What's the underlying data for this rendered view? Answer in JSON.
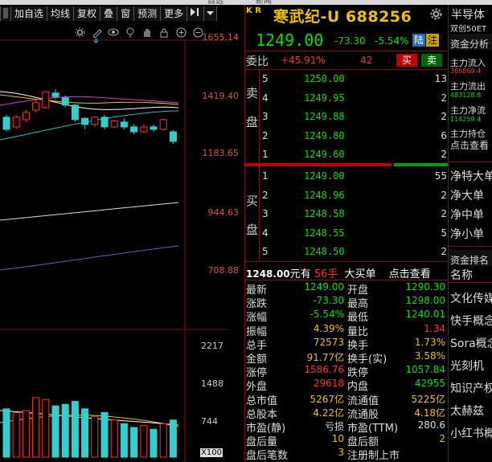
{
  "topstrip": {
    "left_text": "自选",
    "right_text": "新闻"
  },
  "toolbar": {
    "buttons": [
      "加自选",
      "均线",
      "复权",
      "叠",
      "窗",
      "预测",
      "更多"
    ]
  },
  "chart": {
    "price_axis": [
      "1655.14",
      "1419.40",
      "1183.65",
      "944.63",
      "708.88"
    ],
    "volume_axis": [
      "2217",
      "1488",
      "744"
    ],
    "volume_unit": "X100",
    "diamond": "◆"
  },
  "chart_data": {
    "type": "candlestick",
    "ylim": [
      708.88,
      1655.14
    ],
    "candles": [
      {
        "o": 1350,
        "c": 1300,
        "h": 1360,
        "l": 1290,
        "up": false
      },
      {
        "o": 1310,
        "c": 1350,
        "h": 1360,
        "l": 1300,
        "up": true
      },
      {
        "o": 1340,
        "c": 1370,
        "h": 1380,
        "l": 1330,
        "up": true
      },
      {
        "o": 1380,
        "c": 1410,
        "h": 1420,
        "l": 1370,
        "up": true
      },
      {
        "o": 1390,
        "c": 1455,
        "h": 1460,
        "l": 1385,
        "up": true
      },
      {
        "o": 1450,
        "c": 1435,
        "h": 1465,
        "l": 1425,
        "up": false
      },
      {
        "o": 1430,
        "c": 1400,
        "h": 1440,
        "l": 1390,
        "up": false
      },
      {
        "o": 1400,
        "c": 1340,
        "h": 1405,
        "l": 1330,
        "up": false
      },
      {
        "o": 1345,
        "c": 1320,
        "h": 1350,
        "l": 1300,
        "up": false
      },
      {
        "o": 1320,
        "c": 1350,
        "h": 1355,
        "l": 1310,
        "up": true
      },
      {
        "o": 1350,
        "c": 1310,
        "h": 1360,
        "l": 1300,
        "up": false
      },
      {
        "o": 1310,
        "c": 1335,
        "h": 1340,
        "l": 1305,
        "up": true
      },
      {
        "o": 1330,
        "c": 1310,
        "h": 1345,
        "l": 1300,
        "up": false
      },
      {
        "o": 1310,
        "c": 1290,
        "h": 1320,
        "l": 1280,
        "up": false
      },
      {
        "o": 1290,
        "c": 1310,
        "h": 1320,
        "l": 1285,
        "up": true
      },
      {
        "o": 1310,
        "c": 1300,
        "h": 1320,
        "l": 1290,
        "up": false
      },
      {
        "o": 1300,
        "c": 1340,
        "h": 1345,
        "l": 1295,
        "up": true
      },
      {
        "o": 1290,
        "c": 1250,
        "h": 1298,
        "l": 1240,
        "up": false
      }
    ],
    "volumes": [
      1300,
      1200,
      1250,
      1600,
      1550,
      1380,
      1420,
      1500,
      1300,
      1100,
      1200,
      1000,
      900,
      800,
      850,
      750,
      900,
      1000
    ]
  },
  "quote": {
    "kr": "K R",
    "name": "寒武纪-U 688256",
    "price": "1249.00",
    "change": "-73.30",
    "percent": "-5.54%",
    "flag1": "陆",
    "flag2": "注",
    "weibi_label": "委比",
    "weibi_value": "+45.91%",
    "weicha_value": "42",
    "buy_label": "买",
    "sell_label": "卖",
    "ask_side": "卖盘",
    "bid_side": "买盘",
    "asks": [
      {
        "level": "5",
        "price": "1250.00",
        "vol": "13"
      },
      {
        "level": "4",
        "price": "1249.95",
        "vol": "2"
      },
      {
        "level": "3",
        "price": "1249.88",
        "vol": "2"
      },
      {
        "level": "2",
        "price": "1249.80",
        "vol": "6"
      },
      {
        "level": "1",
        "price": "1249.60",
        "vol": "2"
      }
    ],
    "bids": [
      {
        "level": "1",
        "price": "1249.00",
        "vol": "55"
      },
      {
        "level": "2",
        "price": "1248.96",
        "vol": "2"
      },
      {
        "level": "3",
        "price": "1248.58",
        "vol": "2"
      },
      {
        "level": "4",
        "price": "1248.55",
        "vol": "5"
      },
      {
        "level": "5",
        "price": "1248.50",
        "vol": "2"
      }
    ],
    "big_order": {
      "amount": "1248.00",
      "unit": "元有",
      "qty": "56手",
      "type": "大买单",
      "link": "点击查看"
    },
    "stats": [
      {
        "l1": "最新",
        "v1": "1249.00",
        "c1": "g",
        "l2": "开盘",
        "v2": "1290.30",
        "c2": "g"
      },
      {
        "l1": "涨跌",
        "v1": "-73.30",
        "c1": "g",
        "l2": "最高",
        "v2": "1298.00",
        "c2": "g"
      },
      {
        "l1": "涨幅",
        "v1": "-5.54%",
        "c1": "g",
        "l2": "最低",
        "v2": "1240.01",
        "c2": "g"
      },
      {
        "l1": "振幅",
        "v1": "4.39%",
        "c1": "y",
        "l2": "量比",
        "v2": "1.34",
        "c2": "r"
      },
      {
        "l1": "总手",
        "v1": "72573",
        "c1": "y",
        "l2": "换手",
        "v2": "1.73%",
        "c2": "y"
      },
      {
        "l1": "金额",
        "v1": "91.77亿",
        "c1": "y",
        "l2": "换手(实)",
        "v2": "3.58%",
        "c2": "y"
      },
      {
        "l1": "涨停",
        "v1": "1586.76",
        "c1": "r",
        "l2": "跌停",
        "v2": "1057.84",
        "c2": "g"
      },
      {
        "l1": "外盘",
        "v1": "29618",
        "c1": "r",
        "l2": "内盘",
        "v2": "42955",
        "c2": "g"
      },
      {
        "l1": "总市值",
        "v1": "5267亿",
        "c1": "y",
        "l2": "流通值",
        "v2": "5225亿",
        "c2": "y"
      },
      {
        "l1": "总股本",
        "v1": "4.22亿",
        "c1": "y",
        "l2": "流通股",
        "v2": "4.18亿",
        "c2": "y"
      },
      {
        "l1": "市盈(静)",
        "v1": "亏损",
        "c1": "w",
        "l2": "市盈(TTM)",
        "v2": "280.6",
        "c2": "w"
      },
      {
        "l1": "盘后量",
        "v1": "10",
        "c1": "y",
        "l2": "盘后额",
        "v2": "2",
        "c2": "y"
      },
      {
        "l1": "盘后笔数",
        "v1": "3",
        "c1": "y",
        "l2": "注册制上市",
        "v2": "",
        "c2": "w"
      }
    ]
  },
  "rightpanel": {
    "title": "半导体",
    "subtitle": "双创50ET",
    "fund_title": "资金分析",
    "flows": [
      {
        "label": "主力流入",
        "value": "368869.4"
      },
      {
        "label": "主力流出",
        "value": "483128.8"
      },
      {
        "label": "主力净流",
        "value": "114259.4"
      },
      {
        "label": "主力持仓",
        "value": "点击查看"
      }
    ],
    "net": [
      "净特大单",
      "净大单",
      "净中单",
      "净小单"
    ],
    "rank_title": "资金排名",
    "rank_header": "名称",
    "ranks": [
      "文化传媒",
      "快手概念",
      "Sora概念",
      "光刻机",
      "知识产权",
      "太赫兹",
      "小红书概"
    ]
  }
}
